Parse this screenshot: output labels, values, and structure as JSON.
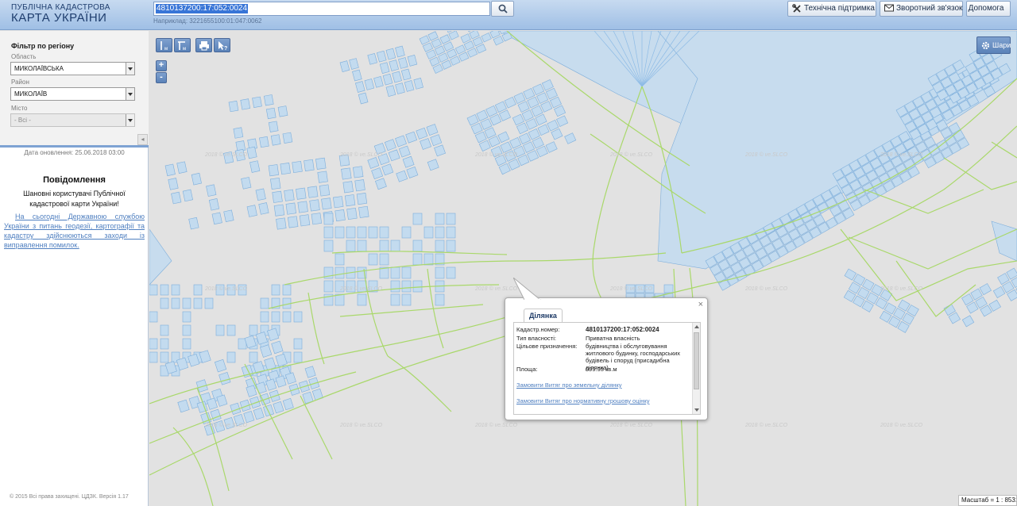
{
  "header": {
    "logo_line1": "ПУБЛІЧНА КАДАСТРОВА",
    "logo_line2": "КАРТА УКРАЇНИ",
    "search_value": "4810137200:17:052:0024",
    "search_hint": "Наприклад: 3221655100:01:047:0062",
    "search_icon": "search-icon",
    "buttons": {
      "support": "Технічна підтримка",
      "feedback": "Зворотний зв'язок",
      "help": "Допомога"
    }
  },
  "sidebar": {
    "filter_title": "Фільтр по регіону",
    "oblast_label": "Область",
    "oblast_value": "МИКОЛАЇВСЬКА",
    "rayon_label": "Район",
    "rayon_value": "МИКОЛАЇВ",
    "city_label": "Місто",
    "city_value": "- Всі -",
    "collapse_glyph": "◂",
    "update_date": "Дата оновлення: 25.06.2018 03:00",
    "notice_title": "Повідомлення",
    "notice_text": "Шановні користувачі Публічної кадастрової карти України!",
    "notice_link": "На сьогодні Державною службою України з питань геодезії, картографії та кадастру здійснюються заходи із виправлення помилок.",
    "copyright": "© 2015 Всі права захищені. ЦДЗК. Версія 1.17"
  },
  "map": {
    "zoom_in": "+",
    "zoom_out": "-",
    "layers_label": "Шари",
    "scale_text": "Масштаб = 1 : 8531",
    "watermark": "2018 © ve.SLCO",
    "colors": {
      "parcel_fill": "#c3dbef",
      "parcel_stroke": "#7daedb",
      "green_line": "#a9d86a",
      "water_fill": "#c7dcee"
    }
  },
  "popup": {
    "tab_label": "Ділянка",
    "close_glyph": "×",
    "fields": [
      {
        "key": "Кадастр.номер:",
        "value": "4810137200:17:052:0024"
      },
      {
        "key": "Тип власності:",
        "value": "Приватна власність"
      },
      {
        "key": "Цільове призначення:",
        "value": "будівництва і обслуговування житлового будинку, господарських будівель і споруд (присадибна ділянка)"
      },
      {
        "key": "Площа:",
        "value": "999.93 кв.м"
      }
    ],
    "link1": "Замовити Витяг про земельну ділянку",
    "link2": "Замовити Витяг про нормативну грошову оцінку"
  }
}
